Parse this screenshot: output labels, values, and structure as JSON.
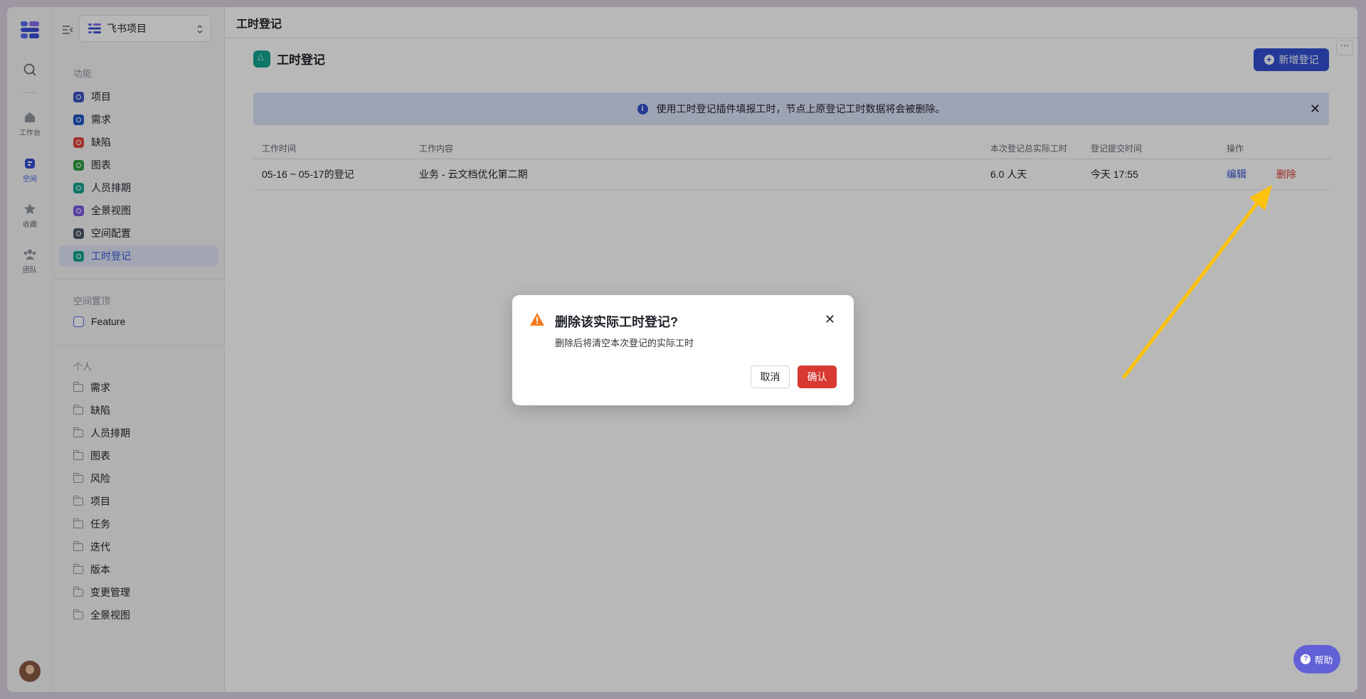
{
  "rail": {
    "items": [
      {
        "label": "工作台",
        "icon": "home-icon"
      },
      {
        "label": "空间",
        "icon": "space-icon"
      },
      {
        "label": "收藏",
        "icon": "star-icon"
      },
      {
        "label": "团队",
        "icon": "team-icon"
      }
    ]
  },
  "sidebar": {
    "project_name": "飞书项目",
    "section_features": "功能",
    "features": [
      {
        "label": "项目",
        "color": "#3a53c5"
      },
      {
        "label": "需求",
        "color": "#1f57c7"
      },
      {
        "label": "缺陷",
        "color": "#e2483d"
      },
      {
        "label": "图表",
        "color": "#2ea043"
      },
      {
        "label": "人员排期",
        "color": "#14a58f"
      },
      {
        "label": "全景视图",
        "color": "#7b5be0"
      },
      {
        "label": "空间配置",
        "color": "#4e5969"
      },
      {
        "label": "工时登记",
        "color": "#14a58f"
      }
    ],
    "section_pinned": "空间置顶",
    "pinned": [
      {
        "label": "Feature"
      }
    ],
    "section_personal": "个人",
    "personal": [
      {
        "label": "需求"
      },
      {
        "label": "缺陷"
      },
      {
        "label": "人员排期"
      },
      {
        "label": "图表"
      },
      {
        "label": "风险"
      },
      {
        "label": "项目"
      },
      {
        "label": "任务"
      },
      {
        "label": "迭代"
      },
      {
        "label": "版本"
      },
      {
        "label": "变更管理"
      },
      {
        "label": "全景视图"
      }
    ]
  },
  "main": {
    "topbar_title": "工时登记",
    "page_title": "工时登记",
    "add_button": "新增登记",
    "banner_text": "使用工时登记插件填报工时，节点上原登记工时数据将会被删除。",
    "table": {
      "headers": [
        "工作时间",
        "工作内容",
        "本次登记总实际工时",
        "登记提交时间",
        "操作"
      ],
      "rows": [
        {
          "time": "05-16 ~ 05-17的登记",
          "content": "业务 - 云文档优化第二期",
          "hours": "6.0 人天",
          "submitted": "今天 17:55",
          "edit": "编辑",
          "delete": "删除"
        }
      ]
    }
  },
  "dialog": {
    "title": "删除该实际工时登记?",
    "description": "删除后将清空本次登记的实际工时",
    "cancel": "取消",
    "confirm": "确认"
  },
  "help": "帮助",
  "colors": {
    "accent": "#3250d2",
    "danger": "#d83931",
    "arrow": "#ffc20e"
  }
}
